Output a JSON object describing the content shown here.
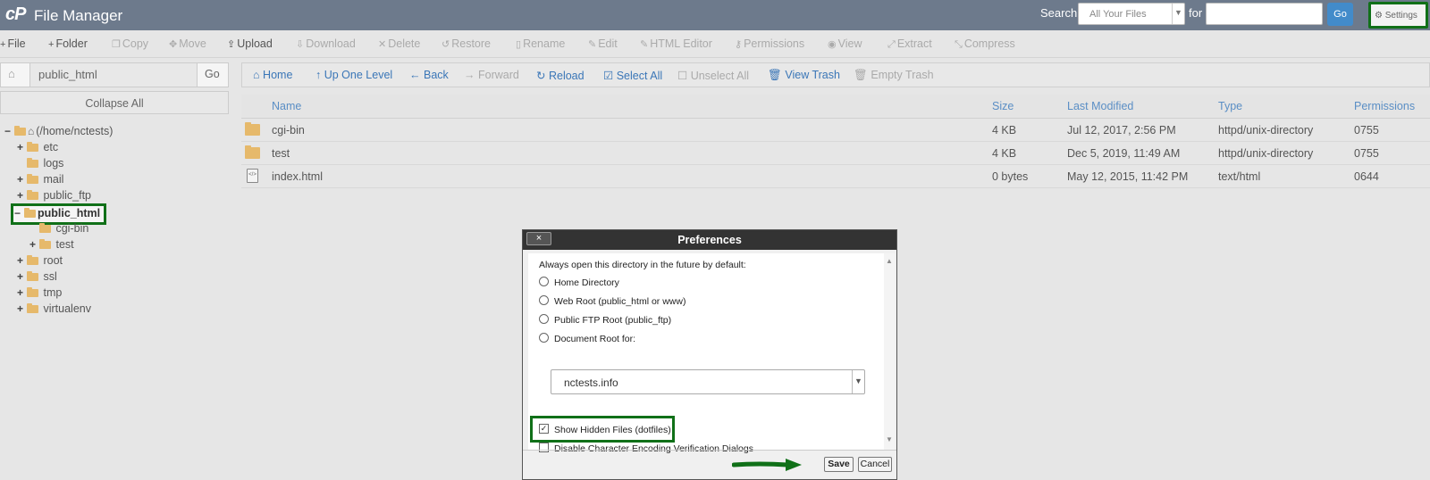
{
  "header": {
    "logo_text": "cP",
    "title": "File Manager",
    "search_label": "Search",
    "search_scope": "All Your Files",
    "for_label": "for",
    "go_label": "Go",
    "settings_label": "Settings"
  },
  "toolbar": {
    "items": [
      {
        "label": "File",
        "icon": "+"
      },
      {
        "label": "Folder",
        "icon": "+"
      },
      {
        "label": "Copy",
        "icon": "❐"
      },
      {
        "label": "Move",
        "icon": "✥"
      },
      {
        "label": "Upload",
        "icon": "⇪"
      },
      {
        "label": "Download",
        "icon": "⇩"
      },
      {
        "label": "Delete",
        "icon": "✕"
      },
      {
        "label": "Restore",
        "icon": "↺"
      },
      {
        "label": "Rename",
        "icon": "▯"
      },
      {
        "label": "Edit",
        "icon": "✎"
      },
      {
        "label": "HTML Editor",
        "icon": "✎"
      },
      {
        "label": "Permissions",
        "icon": "⚷"
      },
      {
        "label": "View",
        "icon": "◉"
      },
      {
        "label": "Extract",
        "icon": "⤢"
      },
      {
        "label": "Compress",
        "icon": "⤡"
      }
    ]
  },
  "left": {
    "path_value": "public_html",
    "go_label": "Go",
    "collapse_label": "Collapse All",
    "tree": [
      {
        "label": "(/home/nctests)",
        "toggle": "−"
      },
      {
        "label": "etc",
        "toggle": "+"
      },
      {
        "label": "logs",
        "toggle": ""
      },
      {
        "label": "mail",
        "toggle": "+"
      },
      {
        "label": "public_ftp",
        "toggle": "+"
      },
      {
        "label": "public_html",
        "toggle": "−"
      },
      {
        "label": "cgi-bin",
        "toggle": ""
      },
      {
        "label": "test",
        "toggle": "+"
      },
      {
        "label": "root",
        "toggle": "+"
      },
      {
        "label": "ssl",
        "toggle": "+"
      },
      {
        "label": "tmp",
        "toggle": "+"
      },
      {
        "label": "virtualenv",
        "toggle": "+"
      }
    ]
  },
  "actionbar": {
    "items": [
      {
        "label": "Home",
        "icon": "⌂"
      },
      {
        "label": "Up One Level",
        "icon": "↑"
      },
      {
        "label": "Back",
        "icon": "←"
      },
      {
        "label": "Forward",
        "icon": "→"
      },
      {
        "label": "Reload",
        "icon": "↻"
      },
      {
        "label": "Select All",
        "icon": "☑"
      },
      {
        "label": "Unselect All",
        "icon": "☐"
      },
      {
        "label": "View Trash",
        "icon": "🗑"
      },
      {
        "label": "Empty Trash",
        "icon": "🗑"
      }
    ]
  },
  "table": {
    "columns": [
      "Name",
      "Size",
      "Last Modified",
      "Type",
      "Permissions"
    ],
    "rows": [
      {
        "name": "cgi-bin",
        "size": "4 KB",
        "modified": "Jul 12, 2017, 2:56 PM",
        "type": "httpd/unix-directory",
        "perms": "0755",
        "kind": "folder"
      },
      {
        "name": "test",
        "size": "4 KB",
        "modified": "Dec 5, 2019, 11:49 AM",
        "type": "httpd/unix-directory",
        "perms": "0755",
        "kind": "folder"
      },
      {
        "name": "index.html",
        "size": "0 bytes",
        "modified": "May 12, 2015, 11:42 PM",
        "type": "text/html",
        "perms": "0644",
        "kind": "file"
      }
    ]
  },
  "dialog": {
    "close_label": "×",
    "title": "Preferences",
    "intro": "Always open this directory in the future by default:",
    "options": [
      "Home Directory",
      "Web Root (public_html or www)",
      "Public FTP Root (public_ftp)",
      "Document Root for:"
    ],
    "docroot_value": "nctests.info",
    "show_hidden_label": "Show Hidden Files (dotfiles)",
    "show_hidden_checked": true,
    "disable_encoding_label": "Disable Character Encoding Verification Dialogs",
    "disable_encoding_checked": false,
    "save_label": "Save",
    "cancel_label": "Cancel"
  },
  "colors": {
    "header_bg": "#6d7a8c",
    "link_blue": "#3a76b7",
    "highlight_green": "#107018",
    "folder": "#e6b96b"
  }
}
